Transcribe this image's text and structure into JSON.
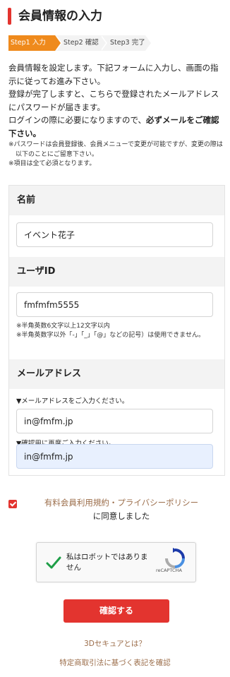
{
  "page": {
    "title": "会員情報の入力"
  },
  "steps": [
    {
      "label": "Step1 入力",
      "active": true
    },
    {
      "label": "Step2 確認",
      "active": false
    },
    {
      "label": "Step3 完了",
      "active": false
    }
  ],
  "intro": {
    "line1": "会員情報を設定します。下記フォームに入力し、画面の指示に従ってお進み下さい。",
    "line2": "登録が完了しますと、こちらで登録されたメールアドレスにパスワードが届きます。",
    "line3_prefix": "ログインの際に必要になりますので、",
    "line3_bold": "必ずメールをご確認下さい。"
  },
  "notes": [
    "※パスワードは会員登録後、会員メニューで変更が可能ですが、変更の際は以下のことにご留意下さい。",
    "※項目は全て必須となります。"
  ],
  "form": {
    "name": {
      "label": "名前",
      "value": "イベント花子"
    },
    "user_id": {
      "label": "ユーザID",
      "value": "fmfmfm5555",
      "hints": [
        "※半角英数6文字以上12文字以内",
        "※半角英数字以外「-」「_」「@」などの記号）は使用できません。"
      ]
    },
    "email": {
      "label": "メールアドレス",
      "instruction": "▼メールアドレスをご入力ください。",
      "value": "in@fmfm.jp",
      "confirm_instruction": "▼確認用に再度ご入力ください。",
      "confirm_value": "in@fmfm.jp"
    }
  },
  "agreement": {
    "terms_link": "有料会員利用規約",
    "separator": "・",
    "privacy_link": "プライバシーポリシー",
    "suffix": "に同意しました",
    "checked": true
  },
  "recaptcha": {
    "label": "私はロボットではありません",
    "brand": "reCAPTCHA",
    "checked": true
  },
  "submit": {
    "label": "確認する"
  },
  "links": {
    "secure3d": "3Dセキュアとは？",
    "law": "特定商取引法に基づく表記を確認"
  },
  "colors": {
    "accent_red": "#e3342f",
    "step_active": "#ef8a1c",
    "link_brown": "#9b6d4a",
    "autofill_blue": "#e8f0fe"
  }
}
